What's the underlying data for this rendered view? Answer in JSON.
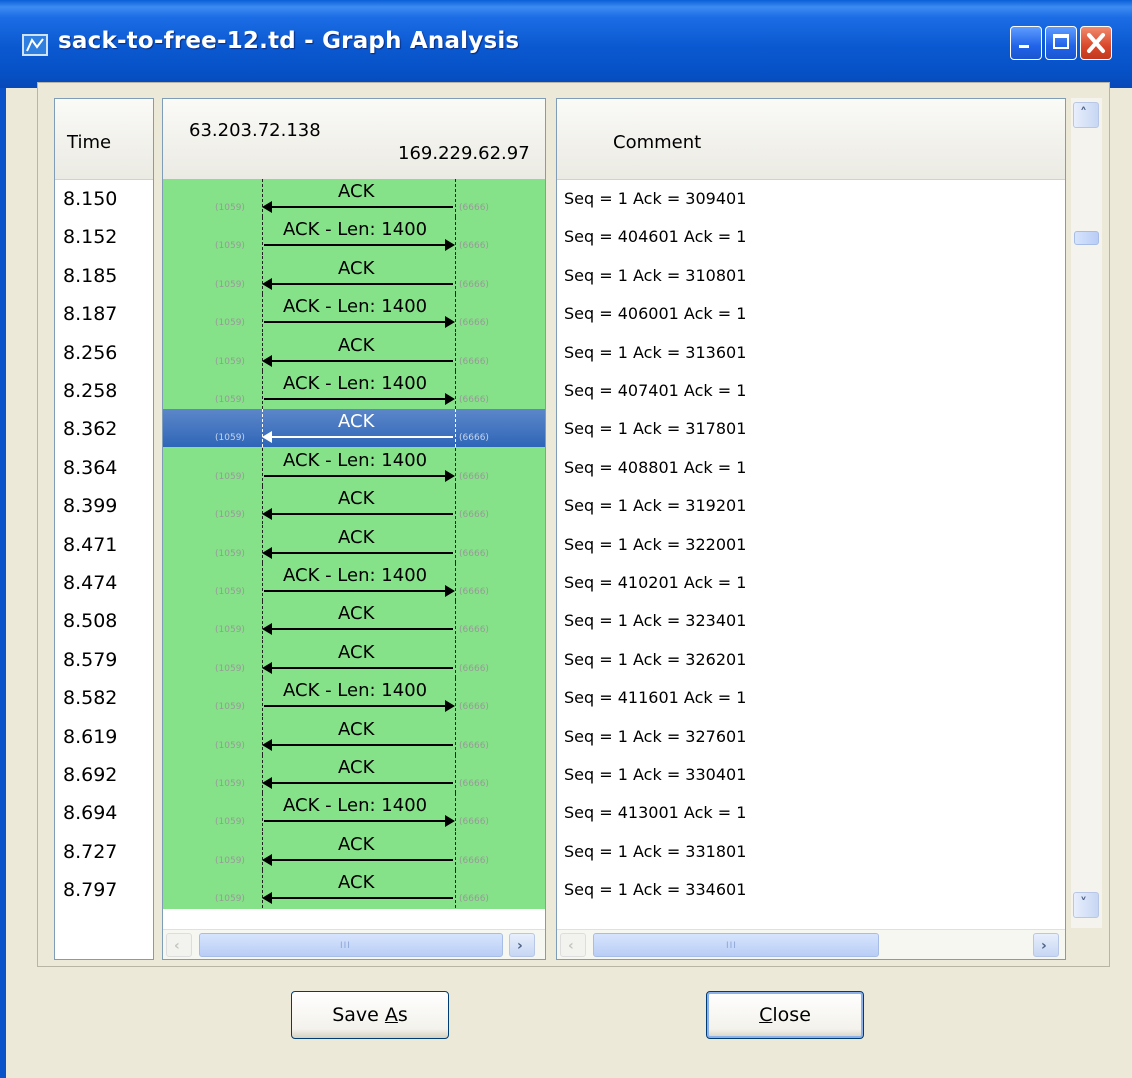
{
  "window": {
    "title": "sack-to-free-12.td - Graph Analysis",
    "buttons": [
      "minimize",
      "maximize",
      "close"
    ]
  },
  "time_column": {
    "header": "Time",
    "values": [
      "8.150",
      "8.152",
      "8.185",
      "8.187",
      "8.256",
      "8.258",
      "8.362",
      "8.364",
      "8.399",
      "8.471",
      "8.474",
      "8.508",
      "8.579",
      "8.582",
      "8.619",
      "8.692",
      "8.694",
      "8.727",
      "8.797"
    ]
  },
  "graph": {
    "node_left": "63.203.72.138",
    "node_right": "169.229.62.97",
    "port_left": "(1059)",
    "port_right": "(6666)",
    "selected_index": 6,
    "arrows": [
      {
        "label": "ACK",
        "dir": "left"
      },
      {
        "label": "ACK - Len: 1400",
        "dir": "right"
      },
      {
        "label": "ACK",
        "dir": "left"
      },
      {
        "label": "ACK - Len: 1400",
        "dir": "right"
      },
      {
        "label": "ACK",
        "dir": "left"
      },
      {
        "label": "ACK - Len: 1400",
        "dir": "right"
      },
      {
        "label": "ACK",
        "dir": "left"
      },
      {
        "label": "ACK - Len: 1400",
        "dir": "right"
      },
      {
        "label": "ACK",
        "dir": "left"
      },
      {
        "label": "ACK",
        "dir": "left"
      },
      {
        "label": "ACK - Len: 1400",
        "dir": "right"
      },
      {
        "label": "ACK",
        "dir": "left"
      },
      {
        "label": "ACK",
        "dir": "left"
      },
      {
        "label": "ACK - Len: 1400",
        "dir": "right"
      },
      {
        "label": "ACK",
        "dir": "left"
      },
      {
        "label": "ACK",
        "dir": "left"
      },
      {
        "label": "ACK - Len: 1400",
        "dir": "right"
      },
      {
        "label": "ACK",
        "dir": "left"
      },
      {
        "label": "ACK",
        "dir": "left"
      }
    ],
    "colors": {
      "flow_bg": "#86E289",
      "selection": "#2F66B8"
    }
  },
  "comment_column": {
    "header": "Comment",
    "values": [
      "Seq = 1 Ack = 309401",
      "Seq = 404601 Ack = 1",
      "Seq = 1 Ack = 310801",
      "Seq = 406001 Ack = 1",
      "Seq = 1 Ack = 313601",
      "Seq = 407401 Ack = 1",
      "Seq = 1 Ack = 317801",
      "Seq = 408801 Ack = 1",
      "Seq = 1 Ack = 319201",
      "Seq = 1 Ack = 322001",
      "Seq = 410201 Ack = 1",
      "Seq = 1 Ack = 323401",
      "Seq = 1 Ack = 326201",
      "Seq = 411601 Ack = 1",
      "Seq = 1 Ack = 327601",
      "Seq = 1 Ack = 330401",
      "Seq = 413001 Ack = 1",
      "Seq = 1 Ack = 331801",
      "Seq = 1 Ack = 334601"
    ]
  },
  "scrollbar_grip": "III",
  "buttons": {
    "save_as_pre": "Save ",
    "save_as_mnemonic": "A",
    "save_as_post": "s",
    "close_mnemonic": "C",
    "close_post": "lose"
  }
}
